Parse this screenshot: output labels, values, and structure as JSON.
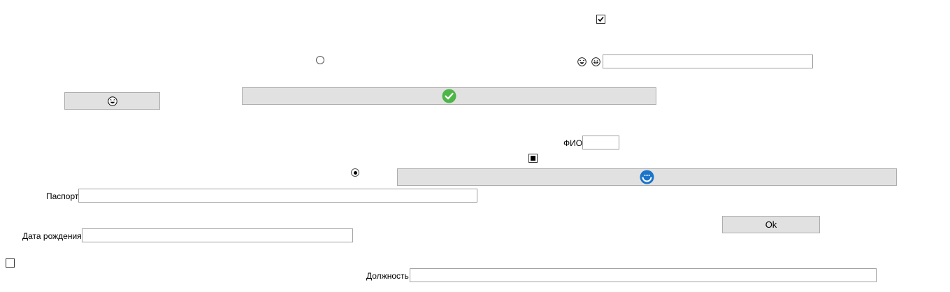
{
  "form": {
    "fio_label": "ФИО",
    "fio_value": "",
    "passport_label": "Паспорт",
    "passport_value": "",
    "birthdate_label": "Дата рождения",
    "birthdate_value": "",
    "position_label": "Должность",
    "position_value": "",
    "top_right_value": "",
    "ok_label": "Ok"
  },
  "controls": {
    "top_checkbox_checked": true,
    "square_checkbox_state": "indeterminate",
    "bottom_checkbox_checked": false,
    "radio_upper_selected": false,
    "radio_lower_selected": true
  },
  "icons": {
    "small_button_icon": "laughing-emoji-icon",
    "wide_button_icon": "check-circle-icon",
    "long_button_icon": "refresh-circle-icon",
    "field_icon_1": "laughing-emoji-icon",
    "field_icon_2": "grinning-emoji-icon"
  },
  "colors": {
    "button_bg": "#e1e1e1",
    "check_green": "#4cb648",
    "refresh_blue": "#1a74c9"
  }
}
